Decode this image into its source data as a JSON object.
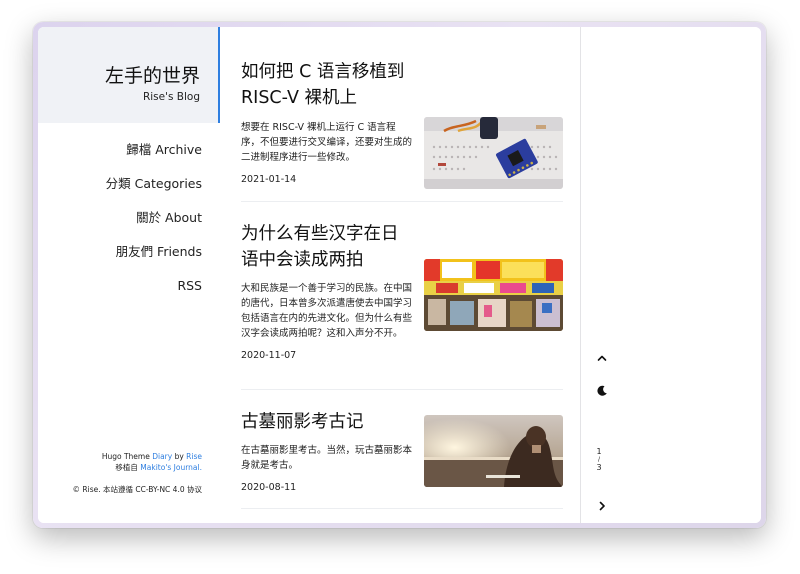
{
  "sidebar": {
    "title": "左手的世界",
    "subtitle": "Rise's Blog",
    "nav": [
      {
        "label": "歸檔 Archive"
      },
      {
        "label": "分類 Categories"
      },
      {
        "label": "關於 About"
      },
      {
        "label": "朋友們 Friends"
      },
      {
        "label": "RSS"
      }
    ],
    "footer": {
      "theme_prefix": "Hugo Theme ",
      "theme_name": "Diary",
      "by": " by ",
      "author": "Rise",
      "ported_prefix": "移植自 ",
      "ported_name": "Makito",
      "ported_suffix": "'s Journal.",
      "copyright": "© Rise. 本站遵循 CC-BY-NC 4.0 协议"
    }
  },
  "posts": [
    {
      "title": "如何把 C 语言移植到 RISC-V 裸机上",
      "excerpt": "想要在 RISC-V 裸机上运行 C 语言程序，不但要进行交叉编译，还要对生成的二进制程序进行一些修改。",
      "date": "2021-01-14"
    },
    {
      "title": "为什么有些汉字在日语中会读成两拍",
      "excerpt": "大和民族是一个善于学习的民族。在中国的唐代，日本曾多次派遣唐使去中国学习包括语言在内的先进文化。但为什么有些汉字会读成两拍呢？这和入声分不开。",
      "date": "2020-11-07"
    },
    {
      "title": "古墓丽影考古记",
      "excerpt": "在古墓丽影里考古。当然，玩古墓丽影本身就是考古。",
      "date": "2020-08-11"
    }
  ],
  "rail": {
    "page_current": "1",
    "page_sep": "/",
    "page_total": "3"
  },
  "colors": {
    "accent": "#2f7fe0",
    "brand_bg": "#f0f2f6"
  }
}
